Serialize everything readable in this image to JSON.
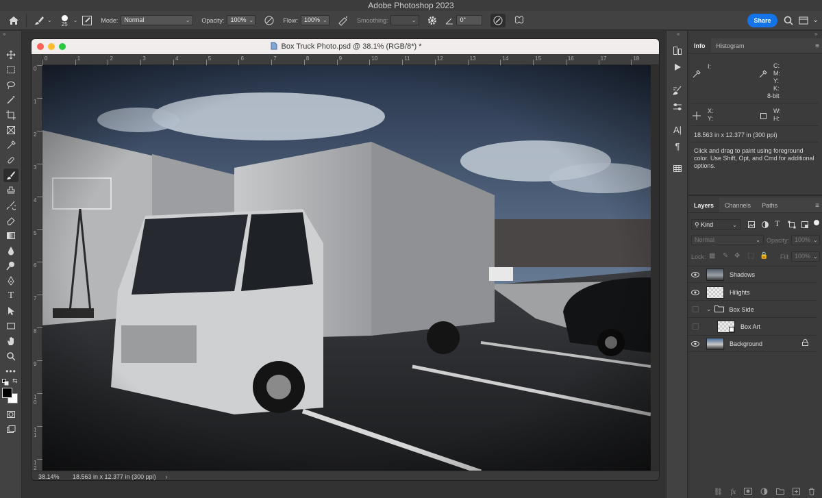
{
  "app": {
    "title": "Adobe Photoshop 2023",
    "share_label": "Share"
  },
  "options_bar": {
    "brush_size": "25",
    "mode_label": "Mode:",
    "mode_value": "Normal",
    "opacity_label": "Opacity:",
    "opacity_value": "100%",
    "flow_label": "Flow:",
    "flow_value": "100%",
    "smoothing_label": "Smoothing:",
    "smoothing_value": "",
    "angle_value": "0°"
  },
  "document": {
    "title": "Box Truck Photo.psd @ 38.1% (RGB/8*) *",
    "zoom": "38.14%",
    "dimensions": "18.563 in x 12.377 in (300 ppi)",
    "h_ruler": [
      "0",
      "1",
      "2",
      "3",
      "4",
      "5",
      "6",
      "7",
      "8",
      "9",
      "10",
      "11",
      "12",
      "13",
      "14",
      "15",
      "16",
      "17",
      "18"
    ],
    "v_ruler": [
      "0",
      "1",
      "2",
      "3",
      "4",
      "5",
      "6",
      "7",
      "8",
      "9",
      "10",
      "11",
      "12"
    ]
  },
  "info_panel": {
    "tabs": [
      "Info",
      "Histogram"
    ],
    "rgb_label": "I:",
    "cmyk_labels": [
      "C:",
      "M:",
      "Y:",
      "K:"
    ],
    "bit_depth": "8-bit",
    "x_label": "X:",
    "y_label": "Y:",
    "w_label": "W:",
    "h_label": "H:",
    "doc_size": "18.563 in x 12.377 in (300 ppi)",
    "hint": "Click and drag to paint using foreground color.  Use Shift, Opt, and Cmd for additional options."
  },
  "layers_panel": {
    "tabs": [
      "Layers",
      "Channels",
      "Paths"
    ],
    "filter_kind": "Kind",
    "blend_mode": "Normal",
    "opacity_label": "Opacity:",
    "opacity_value": "100%",
    "lock_label": "Lock:",
    "fill_label": "Fill:",
    "fill_value": "100%",
    "layers": [
      {
        "name": "Shadows",
        "visible": true
      },
      {
        "name": "Hilights",
        "visible": true
      },
      {
        "name": "Box Side",
        "visible": false,
        "group": true
      },
      {
        "name": "Box Art",
        "visible": false,
        "smart": true
      },
      {
        "name": "Background",
        "visible": true,
        "locked": true
      }
    ]
  },
  "colors": {
    "accent": "#1473e6",
    "panel_bg": "#3b3b3b",
    "toolbar_bg": "#424242"
  }
}
